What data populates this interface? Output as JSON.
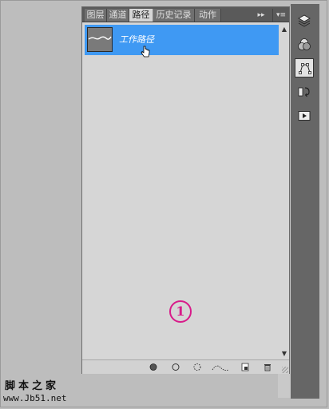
{
  "panel": {
    "tabs": [
      "图层",
      "通道",
      "路径",
      "历史记录",
      "动作"
    ],
    "active_tab": "路径",
    "tab_menu_collapse": "▸▸",
    "tab_menu_options": "▾≡"
  },
  "paths": [
    {
      "name": "工作路径",
      "selected": true
    }
  ],
  "annotation": {
    "marker": "1"
  },
  "bottom_toolbar": {
    "icons": [
      "fill-path-icon",
      "stroke-path-icon",
      "load-selection-icon",
      "make-work-path-icon",
      "new-path-icon",
      "delete-path-icon"
    ]
  },
  "dock": {
    "icons": [
      "layers-icon",
      "channels-icon",
      "paths-icon",
      "history-icon",
      "actions-icon"
    ],
    "active": "paths-icon"
  },
  "watermark": {
    "site_name": "脚本之家",
    "url": "www.Jb51.net"
  },
  "colors": {
    "selection": "#3f99f3",
    "marker": "#d81b8a",
    "tab_bar": "#5a5a5a"
  }
}
